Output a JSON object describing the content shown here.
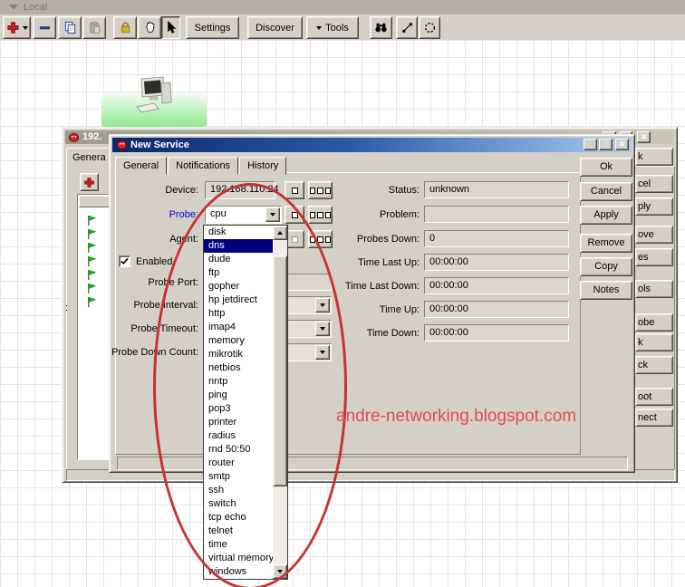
{
  "header": {
    "panel_label": "Local"
  },
  "toolbar": {
    "settings_label": "Settings",
    "discover_label": "Discover",
    "tools_label": "Tools"
  },
  "background_window": {
    "title_visible": "192.",
    "tab_label": "Genera",
    "row_marker": ":",
    "side_button_fragments": [
      "k",
      "cel",
      "ply",
      "ove",
      "es",
      "ols",
      "obe",
      "k",
      "ck",
      "oot",
      "nect"
    ],
    "service_flags": [
      "up",
      "up",
      "up",
      "up",
      "up",
      "up",
      "up"
    ]
  },
  "dialog": {
    "title": "New Service",
    "tabs": [
      {
        "label": "General"
      },
      {
        "label": "Notifications"
      },
      {
        "label": "History"
      }
    ],
    "form": {
      "device_label": "Device:",
      "device_value": "192.168.110.24",
      "probe_label": "Probe:",
      "probe_value": "cpu",
      "agent_label": "Agent:",
      "enabled_label": "Enabled",
      "probe_port_label": "Probe Port:",
      "probe_interval_label": "Probe Interval:",
      "probe_timeout_label": "Probe Timeout:",
      "probe_down_count_label": "Probe Down Count:"
    },
    "status_rows": [
      {
        "label": "Status:",
        "value": "unknown"
      },
      {
        "label": "Problem:",
        "value": ""
      },
      {
        "label": "Probes Down:",
        "value": "0"
      },
      {
        "label": "Time Last Up:",
        "value": "00:00:00"
      },
      {
        "label": "Time Last Down:",
        "value": "00:00:00"
      },
      {
        "label": "Time Up:",
        "value": "00:00:00"
      },
      {
        "label": "Time Down:",
        "value": "00:00:00"
      }
    ],
    "side_buttons": [
      {
        "label": "Ok"
      },
      {
        "label": "Cancel"
      },
      {
        "label": "Apply"
      },
      {
        "label": "Remove"
      },
      {
        "label": "Copy"
      },
      {
        "label": "Notes"
      }
    ]
  },
  "dropdown": {
    "items": [
      "disk",
      "dns",
      "dude",
      "ftp",
      "gopher",
      "hp jetdirect",
      "http",
      "imap4",
      "memory",
      "mikrotik",
      "netbios",
      "nntp",
      "ping",
      "pop3",
      "printer",
      "radius",
      "rnd 50:50",
      "router",
      "smtp",
      "ssh",
      "switch",
      "tcp echo",
      "telnet",
      "time",
      "virtual memory",
      "windows"
    ],
    "selected": "dns"
  },
  "annotation": {
    "watermark": "andre-networking.blogspot.com",
    "ellipse_color": "#c83232",
    "text_color": "#e24c4c"
  },
  "colors": {
    "selected_item_bg": "#000080",
    "probe_label": "#0000e0",
    "title_gradient_left": "#0b256b",
    "title_gradient_right": "#a9cbf0"
  }
}
